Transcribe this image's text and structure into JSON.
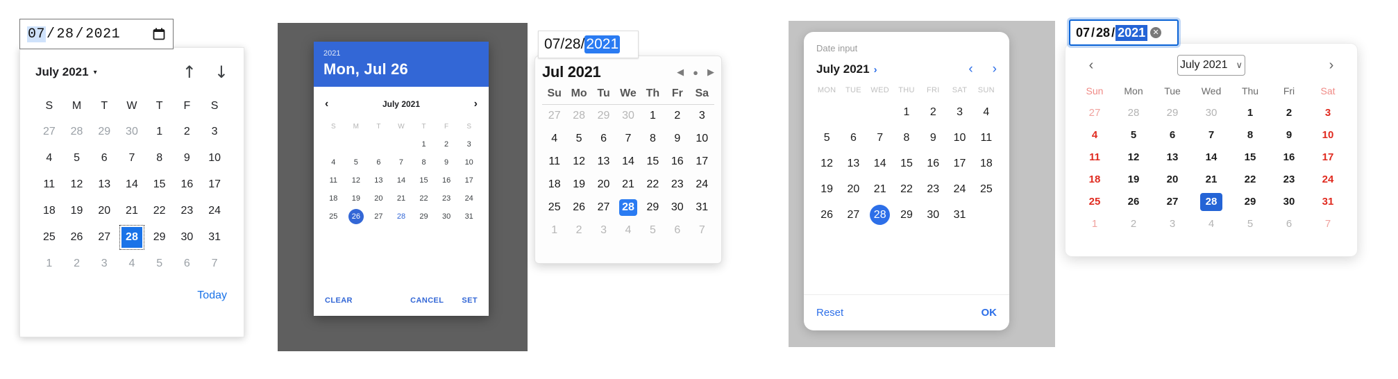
{
  "panel1": {
    "name": "chrome-desktop-datepicker",
    "input": {
      "month": "07",
      "day": "28",
      "year": "2021",
      "sep": "/",
      "selected_segment": "month",
      "icon": "calendar-icon"
    },
    "header": {
      "month_label": "July 2021",
      "caret": "▾",
      "prev_icon": "↑",
      "next_icon": "↓"
    },
    "weekdays": [
      "S",
      "M",
      "T",
      "W",
      "T",
      "F",
      "S"
    ],
    "weeks": [
      [
        {
          "d": "27",
          "o": true
        },
        {
          "d": "28",
          "o": true
        },
        {
          "d": "29",
          "o": true
        },
        {
          "d": "30",
          "o": true
        },
        {
          "d": "1"
        },
        {
          "d": "2"
        },
        {
          "d": "3"
        }
      ],
      [
        {
          "d": "4"
        },
        {
          "d": "5"
        },
        {
          "d": "6"
        },
        {
          "d": "7"
        },
        {
          "d": "8"
        },
        {
          "d": "9"
        },
        {
          "d": "10"
        }
      ],
      [
        {
          "d": "11"
        },
        {
          "d": "12"
        },
        {
          "d": "13"
        },
        {
          "d": "14"
        },
        {
          "d": "15"
        },
        {
          "d": "16"
        },
        {
          "d": "17"
        }
      ],
      [
        {
          "d": "18"
        },
        {
          "d": "19"
        },
        {
          "d": "20"
        },
        {
          "d": "21"
        },
        {
          "d": "22"
        },
        {
          "d": "23"
        },
        {
          "d": "24"
        }
      ],
      [
        {
          "d": "25"
        },
        {
          "d": "26"
        },
        {
          "d": "27"
        },
        {
          "d": "28",
          "s": true
        },
        {
          "d": "29"
        },
        {
          "d": "30"
        },
        {
          "d": "31"
        }
      ],
      [
        {
          "d": "1",
          "o": true
        },
        {
          "d": "2",
          "o": true
        },
        {
          "d": "3",
          "o": true
        },
        {
          "d": "4",
          "o": true
        },
        {
          "d": "5",
          "o": true
        },
        {
          "d": "6",
          "o": true
        },
        {
          "d": "7",
          "o": true
        }
      ]
    ],
    "today_label": "Today",
    "accent": "#1a73e8"
  },
  "panel2": {
    "name": "material-android-datepicker",
    "head": {
      "year": "2021",
      "date": "Mon, Jul 26"
    },
    "nav": {
      "prev_icon": "‹",
      "month_label": "July 2021",
      "next_icon": "›"
    },
    "weekdays": [
      "S",
      "M",
      "T",
      "W",
      "T",
      "F",
      "S"
    ],
    "weeks": [
      [
        {
          "d": ""
        },
        {
          "d": ""
        },
        {
          "d": ""
        },
        {
          "d": ""
        },
        {
          "d": "1"
        },
        {
          "d": "2"
        },
        {
          "d": "3"
        }
      ],
      [
        {
          "d": "4"
        },
        {
          "d": "5"
        },
        {
          "d": "6"
        },
        {
          "d": "7"
        },
        {
          "d": "8"
        },
        {
          "d": "9"
        },
        {
          "d": "10"
        }
      ],
      [
        {
          "d": "11"
        },
        {
          "d": "12"
        },
        {
          "d": "13"
        },
        {
          "d": "14"
        },
        {
          "d": "15"
        },
        {
          "d": "16"
        },
        {
          "d": "17"
        }
      ],
      [
        {
          "d": "18"
        },
        {
          "d": "19"
        },
        {
          "d": "20"
        },
        {
          "d": "21"
        },
        {
          "d": "22"
        },
        {
          "d": "23"
        },
        {
          "d": "24"
        }
      ],
      [
        {
          "d": "25"
        },
        {
          "d": "26",
          "s": true
        },
        {
          "d": "27"
        },
        {
          "d": "28",
          "t": true
        },
        {
          "d": "29"
        },
        {
          "d": "30"
        },
        {
          "d": "31"
        }
      ]
    ],
    "actions": {
      "clear": "CLEAR",
      "cancel": "CANCEL",
      "set": "SET"
    },
    "accent": "#3367d6"
  },
  "panel3": {
    "name": "macos-safari-datepicker",
    "input": {
      "month": "07",
      "day": "28",
      "year": "2021",
      "sep": "/",
      "selected_segment": "year"
    },
    "header": {
      "month_label": "Jul 2021",
      "prev_icon": "◀",
      "today_icon": "●",
      "next_icon": "▶"
    },
    "weekdays": [
      "Su",
      "Mo",
      "Tu",
      "We",
      "Th",
      "Fr",
      "Sa"
    ],
    "weeks": [
      [
        {
          "d": "27",
          "o": true
        },
        {
          "d": "28",
          "o": true
        },
        {
          "d": "29",
          "o": true
        },
        {
          "d": "30",
          "o": true
        },
        {
          "d": "1"
        },
        {
          "d": "2"
        },
        {
          "d": "3"
        }
      ],
      [
        {
          "d": "4"
        },
        {
          "d": "5"
        },
        {
          "d": "6"
        },
        {
          "d": "7"
        },
        {
          "d": "8"
        },
        {
          "d": "9"
        },
        {
          "d": "10"
        }
      ],
      [
        {
          "d": "11"
        },
        {
          "d": "12"
        },
        {
          "d": "13"
        },
        {
          "d": "14"
        },
        {
          "d": "15"
        },
        {
          "d": "16"
        },
        {
          "d": "17"
        }
      ],
      [
        {
          "d": "18"
        },
        {
          "d": "19"
        },
        {
          "d": "20"
        },
        {
          "d": "21"
        },
        {
          "d": "22"
        },
        {
          "d": "23"
        },
        {
          "d": "24"
        }
      ],
      [
        {
          "d": "25"
        },
        {
          "d": "26"
        },
        {
          "d": "27"
        },
        {
          "d": "28",
          "s": true
        },
        {
          "d": "29"
        },
        {
          "d": "30"
        },
        {
          "d": "31"
        }
      ],
      [
        {
          "d": "1",
          "o": true
        },
        {
          "d": "2",
          "o": true
        },
        {
          "d": "3",
          "o": true
        },
        {
          "d": "4",
          "o": true
        },
        {
          "d": "5",
          "o": true
        },
        {
          "d": "6",
          "o": true
        },
        {
          "d": "7",
          "o": true
        }
      ]
    ],
    "accent": "#2a7bf2"
  },
  "panel4": {
    "name": "samsung-mobile-datepicker",
    "label": "Date input",
    "nav": {
      "month_label": "July 2021",
      "expand_icon": "›",
      "prev_icon": "‹",
      "next_icon": "›"
    },
    "weekdays": [
      "MON",
      "TUE",
      "WED",
      "THU",
      "FRI",
      "SAT",
      "SUN"
    ],
    "weeks": [
      [
        {
          "d": ""
        },
        {
          "d": ""
        },
        {
          "d": ""
        },
        {
          "d": "1"
        },
        {
          "d": "2"
        },
        {
          "d": "3"
        },
        {
          "d": "4"
        }
      ],
      [
        {
          "d": "5"
        },
        {
          "d": "6"
        },
        {
          "d": "7"
        },
        {
          "d": "8"
        },
        {
          "d": "9"
        },
        {
          "d": "10"
        },
        {
          "d": "11"
        }
      ],
      [
        {
          "d": "12"
        },
        {
          "d": "13"
        },
        {
          "d": "14"
        },
        {
          "d": "15"
        },
        {
          "d": "16"
        },
        {
          "d": "17"
        },
        {
          "d": "18"
        }
      ],
      [
        {
          "d": "19"
        },
        {
          "d": "20"
        },
        {
          "d": "21"
        },
        {
          "d": "22"
        },
        {
          "d": "23"
        },
        {
          "d": "24"
        },
        {
          "d": "25"
        }
      ],
      [
        {
          "d": "26"
        },
        {
          "d": "27"
        },
        {
          "d": "28",
          "s": true
        },
        {
          "d": "29"
        },
        {
          "d": "30"
        },
        {
          "d": "31"
        },
        {
          "d": ""
        }
      ]
    ],
    "actions": {
      "reset": "Reset",
      "ok": "OK"
    },
    "accent": "#2d6fe8"
  },
  "panel5": {
    "name": "firefox-datepicker",
    "input": {
      "month": "07",
      "day": "28",
      "year": "2021",
      "sep": "/",
      "selected_segment": "year",
      "clear_icon": "✕"
    },
    "header": {
      "prev_icon": "‹",
      "month_label": "July 2021",
      "chevron_icon": "∨",
      "next_icon": "›"
    },
    "weekdays": [
      {
        "l": "Sun",
        "w": true
      },
      {
        "l": "Mon"
      },
      {
        "l": "Tue"
      },
      {
        "l": "Wed"
      },
      {
        "l": "Thu"
      },
      {
        "l": "Fri"
      },
      {
        "l": "Sat",
        "w": true
      }
    ],
    "weeks": [
      [
        {
          "d": "27",
          "o": true,
          "w": true
        },
        {
          "d": "28",
          "o": true
        },
        {
          "d": "29",
          "o": true
        },
        {
          "d": "30",
          "o": true
        },
        {
          "d": "1"
        },
        {
          "d": "2"
        },
        {
          "d": "3",
          "w": true
        }
      ],
      [
        {
          "d": "4",
          "w": true
        },
        {
          "d": "5"
        },
        {
          "d": "6"
        },
        {
          "d": "7"
        },
        {
          "d": "8"
        },
        {
          "d": "9"
        },
        {
          "d": "10",
          "w": true
        }
      ],
      [
        {
          "d": "11",
          "w": true
        },
        {
          "d": "12"
        },
        {
          "d": "13"
        },
        {
          "d": "14"
        },
        {
          "d": "15"
        },
        {
          "d": "16"
        },
        {
          "d": "17",
          "w": true
        }
      ],
      [
        {
          "d": "18",
          "w": true
        },
        {
          "d": "19"
        },
        {
          "d": "20"
        },
        {
          "d": "21"
        },
        {
          "d": "22"
        },
        {
          "d": "23"
        },
        {
          "d": "24",
          "w": true
        }
      ],
      [
        {
          "d": "25",
          "w": true
        },
        {
          "d": "26"
        },
        {
          "d": "27"
        },
        {
          "d": "28",
          "s": true
        },
        {
          "d": "29"
        },
        {
          "d": "30"
        },
        {
          "d": "31",
          "w": true
        }
      ],
      [
        {
          "d": "1",
          "o": true,
          "w": true
        },
        {
          "d": "2",
          "o": true
        },
        {
          "d": "3",
          "o": true
        },
        {
          "d": "4",
          "o": true
        },
        {
          "d": "5",
          "o": true
        },
        {
          "d": "6",
          "o": true
        },
        {
          "d": "7",
          "o": true,
          "w": true
        }
      ]
    ],
    "accent": "#2464d6",
    "weekend_color": "#e02b20"
  }
}
